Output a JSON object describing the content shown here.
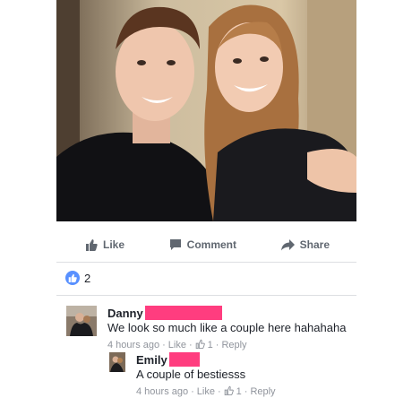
{
  "actions": {
    "like_label": "Like",
    "comment_label": "Comment",
    "share_label": "Share"
  },
  "reactions": {
    "like_count": "2"
  },
  "comments": [
    {
      "name": "Danny",
      "text": "We look so much like a couple here hahahaha",
      "time": "4 hours ago",
      "like_label": "Like",
      "like_count": "1",
      "reply_label": "Reply"
    },
    {
      "name": "Emily",
      "text": "A couple of bestiesss",
      "time": "4 hours ago",
      "like_label": "Like",
      "like_count": "1",
      "reply_label": "Reply"
    }
  ],
  "colors": {
    "redaction": "#ff3d7f",
    "like_badge": "#5890ff",
    "action_gray": "#606770"
  }
}
